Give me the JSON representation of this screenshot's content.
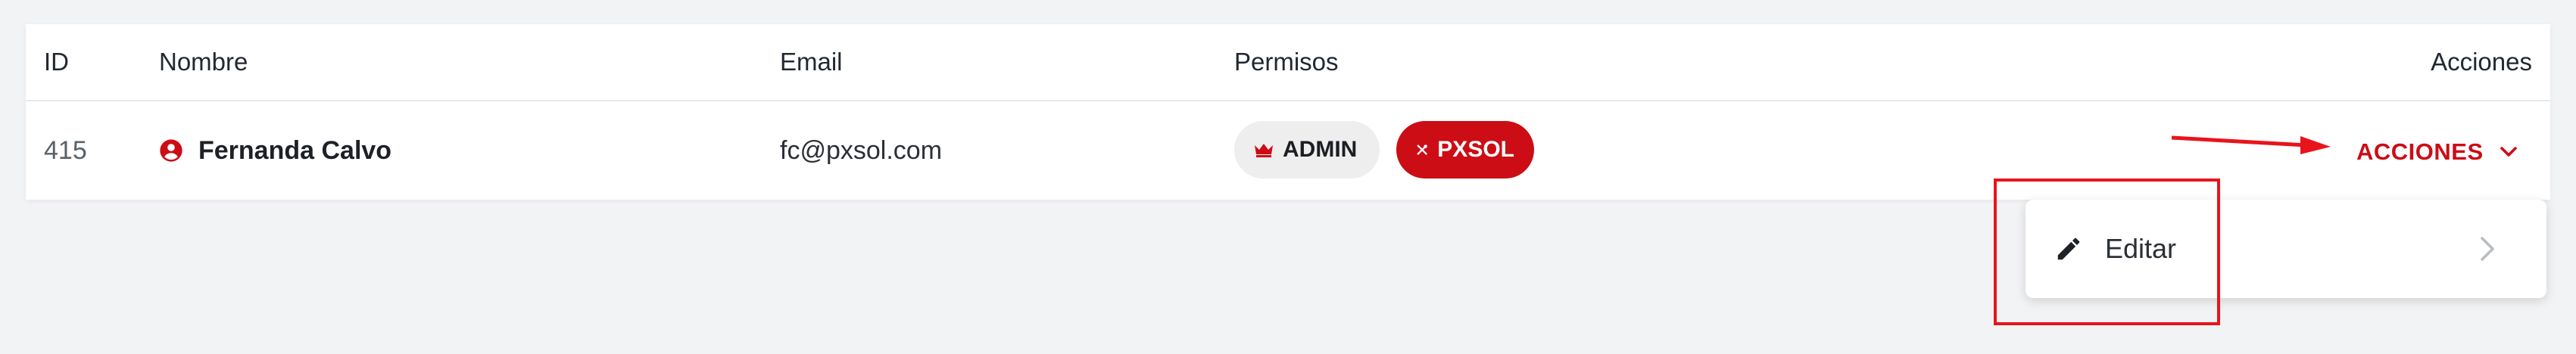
{
  "table": {
    "headers": {
      "id": "ID",
      "name": "Nombre",
      "email": "Email",
      "permissions": "Permisos",
      "actions": "Acciones"
    },
    "rows": [
      {
        "id": "415",
        "name": "Fernanda Calvo",
        "name_icon": "user-circle-icon",
        "email": "fc@pxsol.com",
        "permissions": [
          {
            "label": "ADMIN",
            "icon": "crown-icon"
          },
          {
            "label": "PXSOL",
            "icon": "tools-icon"
          }
        ]
      }
    ]
  },
  "actions_button": {
    "label": "ACCIONES",
    "icon": "chevron-down-icon"
  },
  "menu": {
    "items": [
      {
        "label": "Editar",
        "icon": "pencil-icon",
        "trailing_icon": "chevron-right-icon"
      }
    ]
  },
  "colors": {
    "accent": "#cc0d15",
    "annotation": "#e8141c",
    "background": "#f2f3f5"
  }
}
